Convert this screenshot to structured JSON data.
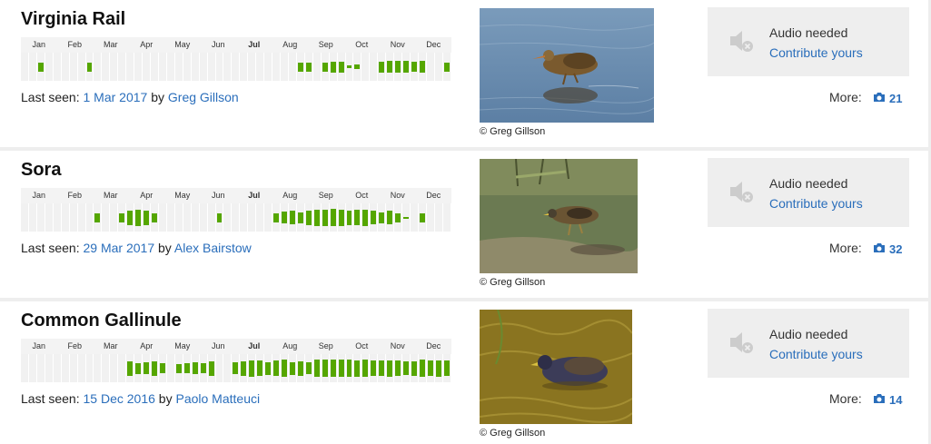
{
  "months": [
    "Jan",
    "Feb",
    "Mar",
    "Apr",
    "May",
    "Jun",
    "Jul",
    "Aug",
    "Sep",
    "Oct",
    "Nov",
    "Dec"
  ],
  "current_month_index": 6,
  "accent_color": "#55a600",
  "link_color": "#2a6ebb",
  "species": [
    {
      "name": "Virginia Rail",
      "last_seen_label": "Last seen:",
      "last_seen_date": "1 Mar 2017",
      "by_label": "by",
      "observer": "Greg Gillson",
      "photo_credit": "© Greg Gillson",
      "audio_needed": "Audio needed",
      "contribute": "Contribute yours",
      "more_label": "More:",
      "photo_count": "21",
      "weekly_frequency": [
        0,
        0,
        0.55,
        0,
        0,
        0,
        0,
        0,
        0.55,
        0,
        0,
        0,
        0,
        0,
        0,
        0,
        0,
        0,
        0,
        0,
        0,
        0,
        0,
        0,
        0,
        0,
        0,
        0,
        0,
        0,
        0,
        0,
        0,
        0,
        0.5,
        0.5,
        0,
        0.5,
        0.65,
        0.65,
        0.15,
        0.25,
        0,
        0,
        0.65,
        0.7,
        0.7,
        0.7,
        0.6,
        0.7,
        0,
        0,
        0.5
      ]
    },
    {
      "name": "Sora",
      "last_seen_label": "Last seen:",
      "last_seen_date": "29 Mar 2017",
      "by_label": "by",
      "observer": "Alex Bairstow",
      "photo_credit": "© Greg Gillson",
      "audio_needed": "Audio needed",
      "contribute": "Contribute yours",
      "more_label": "More:",
      "photo_count": "32",
      "weekly_frequency": [
        0,
        0,
        0,
        0,
        0,
        0,
        0,
        0,
        0,
        0.55,
        0,
        0,
        0.55,
        0.85,
        0.95,
        0.85,
        0.55,
        0,
        0,
        0,
        0,
        0,
        0,
        0,
        0.55,
        0,
        0,
        0,
        0,
        0,
        0,
        0.5,
        0.7,
        0.8,
        0.65,
        0.85,
        0.95,
        0.95,
        1,
        0.95,
        0.85,
        0.9,
        0.95,
        0.8,
        0.65,
        0.8,
        0.55,
        0.12,
        0,
        0.55,
        0,
        0,
        0
      ]
    },
    {
      "name": "Common Gallinule",
      "last_seen_label": "Last seen:",
      "last_seen_date": "15 Dec 2016",
      "by_label": "by",
      "observer": "Paolo Matteuci",
      "photo_credit": "© Gillson",
      "photo_credit_full": "© Greg Gillson",
      "audio_needed": "Audio needed",
      "contribute": "Contribute yours",
      "more_label": "More:",
      "photo_count": "14",
      "weekly_frequency": [
        0,
        0,
        0,
        0,
        0,
        0,
        0,
        0,
        0,
        0,
        0,
        0,
        0,
        0.85,
        0.65,
        0.7,
        0.85,
        0.6,
        0,
        0.55,
        0.6,
        0.7,
        0.6,
        0.85,
        0,
        0,
        0.7,
        0.85,
        0.95,
        0.9,
        0.75,
        0.9,
        1,
        0.75,
        0.85,
        0.7,
        1,
        1,
        1,
        1,
        1,
        0.95,
        1,
        0.9,
        0.9,
        0.95,
        0.9,
        0.8,
        0.85,
        1,
        0.9,
        0.95,
        0.9
      ]
    }
  ]
}
